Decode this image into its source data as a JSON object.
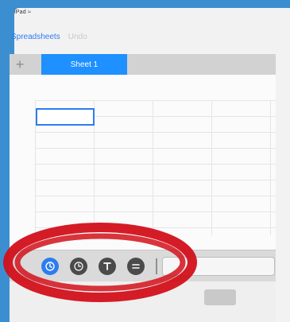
{
  "statusbar": {
    "device_label": "iPad"
  },
  "nav": {
    "spreadsheets_label": "Spreadsheets",
    "undo_label": "Undo"
  },
  "tabs": {
    "add_symbol": "+",
    "active_label": "Sheet 1"
  },
  "toolbar": {
    "tools": [
      {
        "icon": "history-icon",
        "state": "active"
      },
      {
        "icon": "clock-icon",
        "state": "normal"
      },
      {
        "icon": "text-format-icon",
        "state": "normal"
      },
      {
        "icon": "equal-icon",
        "state": "normal"
      }
    ]
  },
  "colors": {
    "accent": "#2d7cf0",
    "tab_active": "#1e90ff",
    "annotation": "#d2101a",
    "border": "#3b8fd0"
  }
}
